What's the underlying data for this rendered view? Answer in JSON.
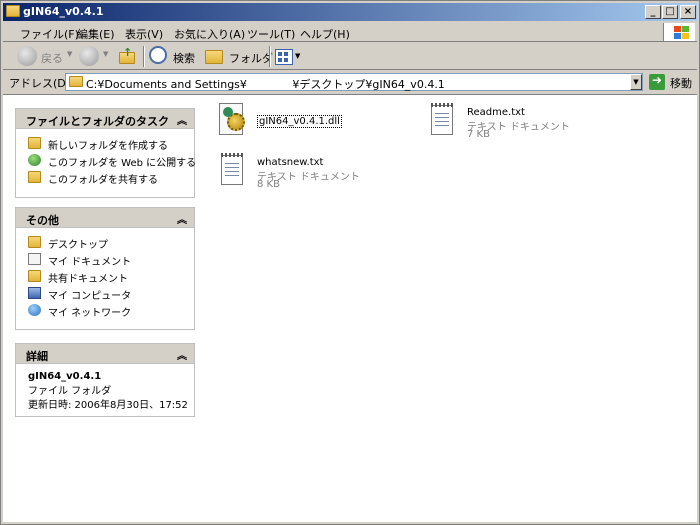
{
  "window": {
    "title": "gIN64_v0.4.1",
    "buttons": {
      "minimize": "_",
      "maximize": "□",
      "close": "×"
    }
  },
  "menu": [
    "ファイル(F)",
    "編集(E)",
    "表示(V)",
    "お気に入り(A)",
    "ツール(T)",
    "ヘルプ(H)"
  ],
  "toolbar": {
    "back": "戻る",
    "search": "検索",
    "folders": "フォルダ"
  },
  "address": {
    "label": "アドレス(D)",
    "path": "C:¥Documents and Settings¥             ¥デスクトップ¥gIN64_v0.4.1",
    "go": "移動"
  },
  "panes": {
    "tasks": {
      "title": "ファイルとフォルダのタスク",
      "items": [
        {
          "label": "新しいフォルダを作成する",
          "icon": "new-folder-icon"
        },
        {
          "label": "このフォルダを Web に公開する",
          "icon": "web-publish-icon"
        },
        {
          "label": "このフォルダを共有する",
          "icon": "share-folder-icon"
        }
      ]
    },
    "other": {
      "title": "その他",
      "items": [
        {
          "label": "デスクトップ",
          "icon": "desktop-folder-icon"
        },
        {
          "label": "マイ ドキュメント",
          "icon": "my-documents-icon"
        },
        {
          "label": "共有ドキュメント",
          "icon": "shared-documents-icon"
        },
        {
          "label": "マイ コンピュータ",
          "icon": "my-computer-icon"
        },
        {
          "label": "マイ ネットワーク",
          "icon": "my-network-icon"
        }
      ]
    },
    "details": {
      "title": "詳細",
      "name": "gIN64_v0.4.1",
      "type": "ファイル フォルダ",
      "modified": "更新日時: 2006年8月30日、17:52"
    }
  },
  "files": [
    {
      "name": "gIN64_v0.4.1.dll",
      "icon": "dll-file-icon"
    },
    {
      "name": "Readme.txt",
      "type": "テキスト ドキュメント",
      "size": "7 KB",
      "icon": "text-file-icon"
    },
    {
      "name": "whatsnew.txt",
      "type": "テキスト ドキュメント",
      "size": "8 KB",
      "icon": "text-file-icon"
    }
  ]
}
